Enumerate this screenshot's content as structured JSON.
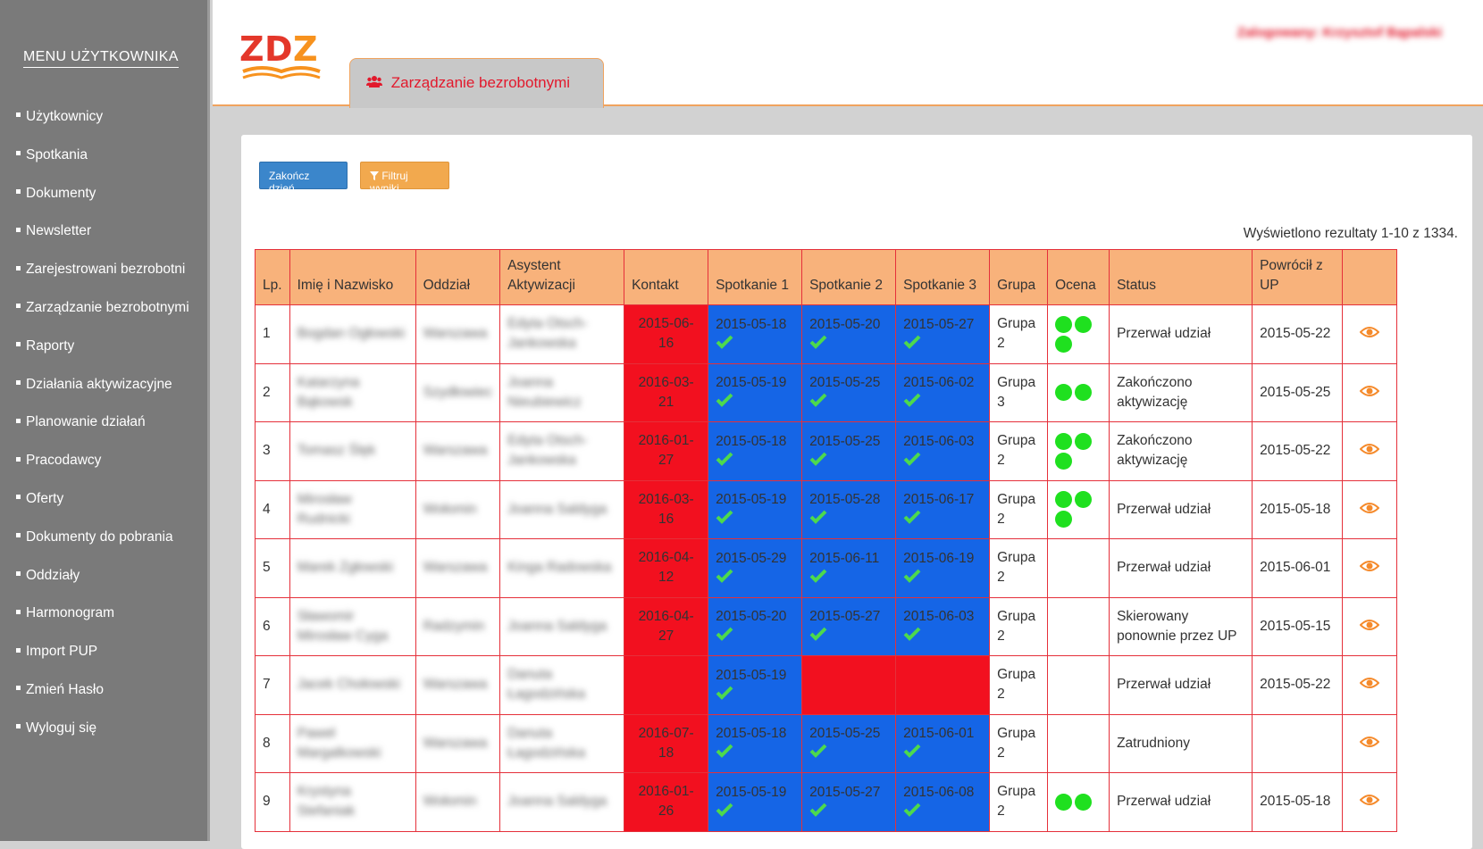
{
  "sidebar": {
    "title": "MENU UŻYTKOWNIKA",
    "items": [
      "Użytkownicy",
      "Spotkania",
      "Dokumenty",
      "Newsletter",
      "Zarejestrowani bezrobotni",
      "Zarządzanie bezrobotnymi",
      "Raporty",
      "Działania aktywizacyjne",
      "Planowanie działań",
      "Pracodawcy",
      "Oferty",
      "Dokumenty do pobrania",
      "Oddziały",
      "Harmonogram",
      "Import PUP",
      "Zmień Hasło",
      "Wyloguj się"
    ]
  },
  "header": {
    "logo": "ZDZ",
    "tab_label": "Zarządzanie bezrobotnymi",
    "tab_icon": "users-icon",
    "user_label": "Zalogowany: Krzysztof Bąpalski"
  },
  "toolbar": {
    "end_day_label": "Zakończ dzień",
    "filter_label": "Filtruj wyniki",
    "filter_icon": "filter-icon"
  },
  "result_info": "Wyświetlono rezultaty 1-10 z 1334.",
  "table": {
    "headers": [
      "Lp.",
      "Imię i Nazwisko",
      "Oddział",
      "Asystent Aktywizacji",
      "Kontakt",
      "Spotkanie 1",
      "Spotkanie 2",
      "Spotkanie 3",
      "Grupa",
      "Ocena",
      "Status",
      "Powrócił z UP",
      ""
    ],
    "rows": [
      {
        "lp": "1",
        "name": "Bogdan Ogłowski",
        "branch": "Warszawa",
        "assistant": "Edyta Otsch-Jankowska",
        "contact": "2015-06-16",
        "m1": "2015-05-18",
        "m2": "2015-05-20",
        "m3": "2015-05-27",
        "group": "Grupa 2",
        "dots": 3,
        "status": "Przerwał udział",
        "returned": "2015-05-22"
      },
      {
        "lp": "2",
        "name": "Katarzyna Bąkowsk",
        "branch": "Szydłowiec",
        "assistant": "Joanna Nieubiewicz",
        "contact": "2016-03-21",
        "m1": "2015-05-19",
        "m2": "2015-05-25",
        "m3": "2015-06-02",
        "group": "Grupa 3",
        "dots": 2,
        "status": "Zakończono aktywizację",
        "returned": "2015-05-25"
      },
      {
        "lp": "3",
        "name": "Tomasz Ślęk",
        "branch": "Warszawa",
        "assistant": "Edyta Otsch-Jankowska",
        "contact": "2016-01-27",
        "m1": "2015-05-18",
        "m2": "2015-05-25",
        "m3": "2015-06-03",
        "group": "Grupa 2",
        "dots": 3,
        "status": "Zakończono aktywizację",
        "returned": "2015-05-22"
      },
      {
        "lp": "4",
        "name": "Mirosław Rudnicki",
        "branch": "Wołomin",
        "assistant": "Joanna Saldyga",
        "contact": "2016-03-16",
        "m1": "2015-05-19",
        "m2": "2015-05-28",
        "m3": "2015-06-17",
        "group": "Grupa 2",
        "dots": 3,
        "status": "Przerwał udział",
        "returned": "2015-05-18"
      },
      {
        "lp": "5",
        "name": "Marek Zgłowski",
        "branch": "Warszawa",
        "assistant": "Kinga Radowska",
        "contact": "2016-04-12",
        "m1": "2015-05-29",
        "m2": "2015-06-11",
        "m3": "2015-06-19",
        "group": "Grupa 2",
        "dots": 0,
        "status": "Przerwał udział",
        "returned": "2015-06-01"
      },
      {
        "lp": "6",
        "name": "Sławomir Mirosław Cyga",
        "branch": "Radzymin",
        "assistant": "Joanna Saldyga",
        "contact": "2016-04-27",
        "m1": "2015-05-20",
        "m2": "2015-05-27",
        "m3": "2015-06-03",
        "group": "Grupa 2",
        "dots": 0,
        "status": "Skierowany ponownie przez UP",
        "returned": "2015-05-15"
      },
      {
        "lp": "7",
        "name": "Jacek Chołowski",
        "branch": "Warszawa",
        "assistant": "Danuta Łagodzińska",
        "contact": "",
        "m1": "2015-05-19",
        "m2": "",
        "m3": "",
        "group": "Grupa 2",
        "dots": 0,
        "status": "Przerwał udział",
        "returned": "2015-05-22"
      },
      {
        "lp": "8",
        "name": "Paweł Margalkowski",
        "branch": "Warszawa",
        "assistant": "Danuta Łagodzińska",
        "contact": "2016-07-18",
        "m1": "2015-05-18",
        "m2": "2015-05-25",
        "m3": "2015-06-01",
        "group": "Grupa 2",
        "dots": 0,
        "status": "Zatrudniony",
        "returned": ""
      },
      {
        "lp": "9",
        "name": "Krystyna Stefaniak",
        "branch": "Wołomin",
        "assistant": "Joanna Saldyga",
        "contact": "2016-01-26",
        "m1": "2015-05-19",
        "m2": "2015-05-27",
        "m3": "2015-06-08",
        "group": "Grupa 2",
        "dots": 2,
        "status": "Przerwał udział",
        "returned": "2015-05-18"
      }
    ]
  },
  "colors": {
    "sidebar_bg": "#7a7a7a",
    "accent_red": "#e2192c",
    "accent_orange": "#f8b27b",
    "cell_red": "#f2101f",
    "cell_blue": "#1565e6",
    "dot_green": "#1fe01f",
    "check_green": "#4dd94d",
    "eye_orange": "#f58a2b"
  }
}
